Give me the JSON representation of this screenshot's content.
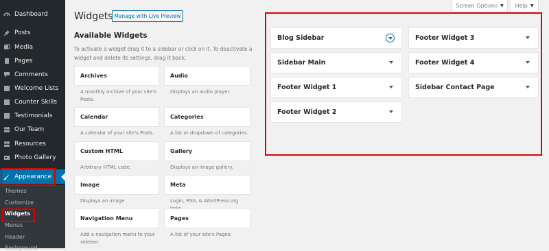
{
  "menu": {
    "items": [
      {
        "label": "Dashboard",
        "icon": "dashboard-icon"
      },
      {
        "label": "Posts",
        "icon": "pin-icon"
      },
      {
        "label": "Media",
        "icon": "media-icon"
      },
      {
        "label": "Pages",
        "icon": "page-icon"
      },
      {
        "label": "Comments",
        "icon": "comment-icon"
      },
      {
        "label": "Welcome Lists",
        "icon": "list-icon"
      },
      {
        "label": "Counter Skills",
        "icon": "counter-icon"
      },
      {
        "label": "Testimonials",
        "icon": "quote-icon"
      },
      {
        "label": "Our Team",
        "icon": "team-icon"
      },
      {
        "label": "Resources",
        "icon": "resources-icon"
      },
      {
        "label": "Photo Gallery",
        "icon": "gallery-icon"
      }
    ],
    "current": {
      "label": "Appearance",
      "icon": "brush-icon"
    },
    "submenu": [
      "Themes",
      "Customize",
      "Widgets",
      "Menus",
      "Header",
      "Background"
    ],
    "accent": "#0073aa",
    "highlight": "#e00000"
  },
  "header": {
    "title": "Widgets",
    "preview_button": "Manage with Live Preview",
    "screen_options": "Screen Options",
    "help": "Help"
  },
  "available": {
    "title": "Available Widgets",
    "description": "To activate a widget drag it to a sidebar or click on it. To deactivate a widget and delete its settings, drag it back.",
    "widgets": [
      {
        "title": "Archives",
        "desc": "A monthly archive of your site's Posts."
      },
      {
        "title": "Audio",
        "desc": "Displays an audio player."
      },
      {
        "title": "Calendar",
        "desc": "A calendar of your site's Posts."
      },
      {
        "title": "Categories",
        "desc": "A list or dropdown of categories."
      },
      {
        "title": "Custom HTML",
        "desc": "Arbitrary HTML code."
      },
      {
        "title": "Gallery",
        "desc": "Displays an image gallery."
      },
      {
        "title": "Image",
        "desc": "Displays an image."
      },
      {
        "title": "Meta",
        "desc": "Login, RSS, & WordPress.org links."
      },
      {
        "title": "Navigation Menu",
        "desc": "Add a navigation menu to your sidebar."
      },
      {
        "title": "Pages",
        "desc": "A list of your site's Pages."
      }
    ]
  },
  "sidebars": [
    {
      "name": "Blog Sidebar"
    },
    {
      "name": "Footer Widget 3"
    },
    {
      "name": "Sidebar Main"
    },
    {
      "name": "Footer Widget 4"
    },
    {
      "name": "Footer Widget 1"
    },
    {
      "name": "Sidebar Contact Page"
    },
    {
      "name": "Footer Widget 2"
    }
  ]
}
